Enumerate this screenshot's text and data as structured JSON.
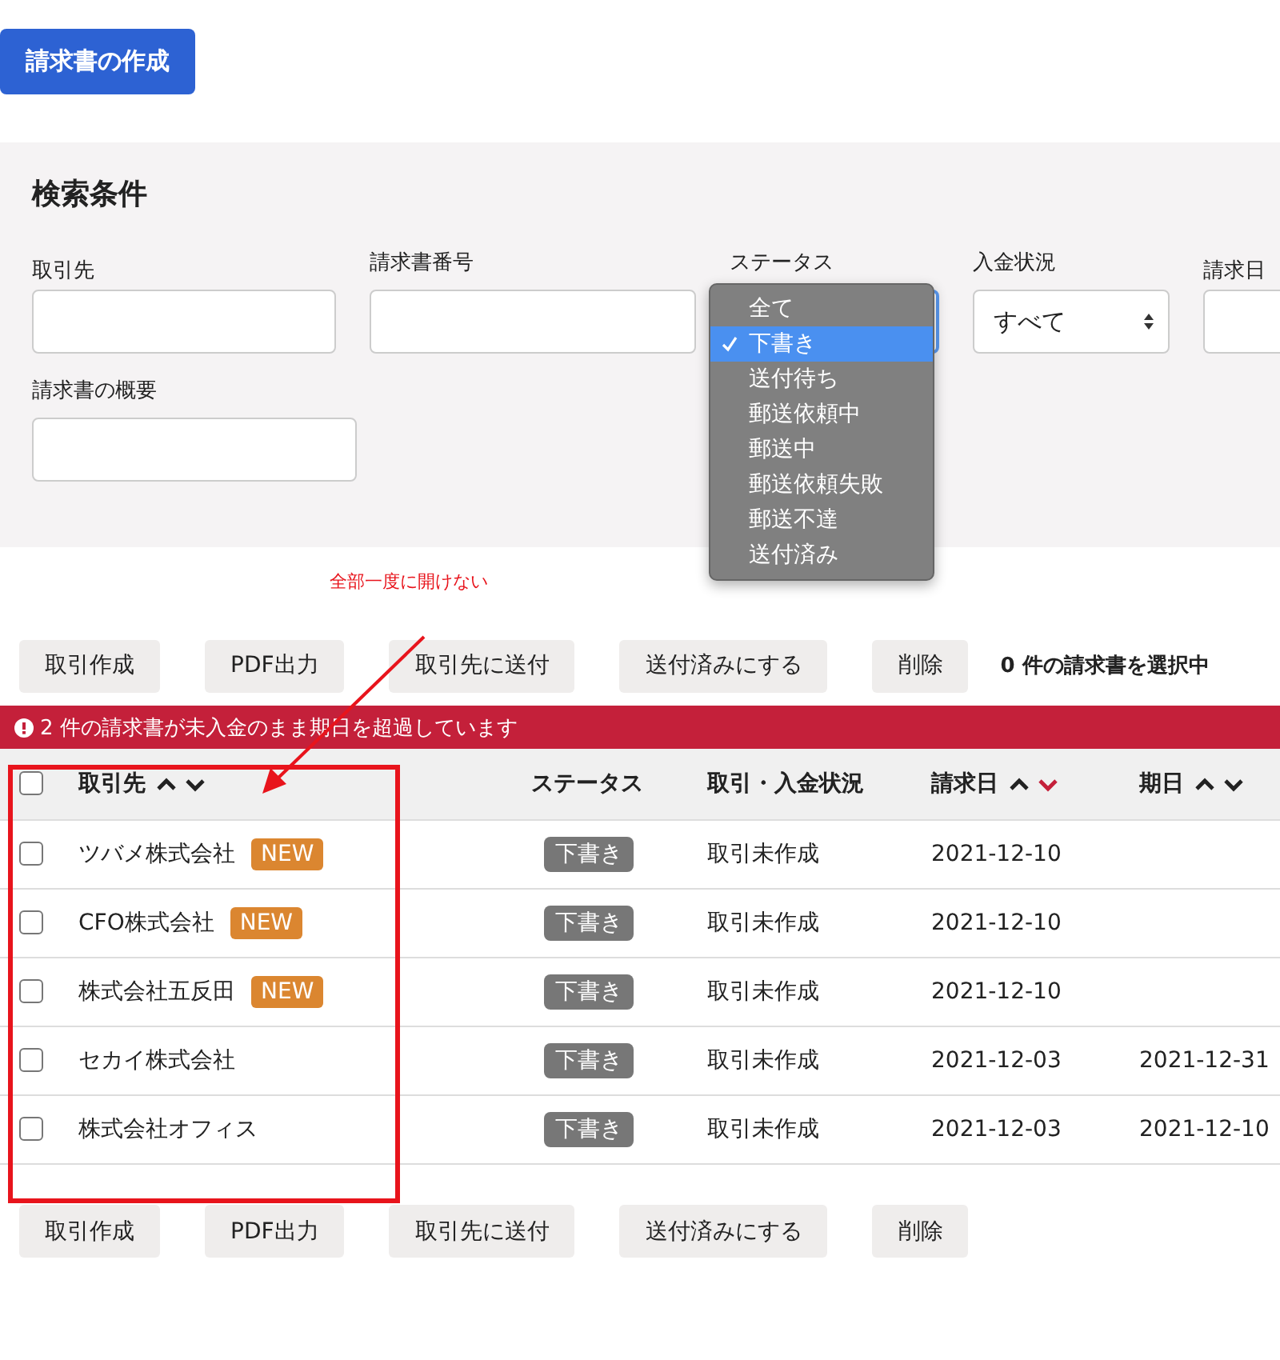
{
  "create_button": "請求書の作成",
  "search": {
    "title": "検索条件",
    "rows": [
      [
        {
          "label": "取引先",
          "kind": "text"
        },
        {
          "label": "請求書番号",
          "kind": "text"
        },
        {
          "label": "ステータス",
          "kind": "select_open"
        },
        {
          "label": "入金状況",
          "kind": "select",
          "value": "すべて"
        },
        {
          "label": "請求日",
          "kind": "text"
        }
      ],
      [
        {
          "label": "請求書の概要",
          "kind": "text"
        }
      ]
    ]
  },
  "status_menu": {
    "options": [
      {
        "label": "全て",
        "selected": false
      },
      {
        "label": "下書き",
        "selected": true
      },
      {
        "label": "送付待ち",
        "selected": false
      },
      {
        "label": "郵送依頼中",
        "selected": false
      },
      {
        "label": "郵送中",
        "selected": false
      },
      {
        "label": "郵送依頼失敗",
        "selected": false
      },
      {
        "label": "郵送不達",
        "selected": false
      },
      {
        "label": "送付済み",
        "selected": false
      }
    ]
  },
  "annotation": {
    "text": "全部一度に開けない"
  },
  "actions": [
    "取引作成",
    "PDF出力",
    "取引先に送付",
    "送付済みにする",
    "削除"
  ],
  "selection_count": "0 件の請求書を選択中",
  "alert": "2 件の請求書が未入金のまま期日を超過しています",
  "table": {
    "all_checked": false,
    "columns": [
      {
        "label": "取引先",
        "sortable": true,
        "sorted_desc": false
      },
      {
        "label": "ステータス",
        "sortable": false
      },
      {
        "label": "取引・入金状況",
        "sortable": false
      },
      {
        "label": "請求日",
        "sortable": true,
        "sorted_desc": true
      },
      {
        "label": "期日",
        "sortable": true,
        "sorted_desc": false
      }
    ],
    "rows": [
      {
        "checked": false,
        "name": "ツバメ株式会社",
        "badge": "NEW",
        "status": "下書き",
        "deal": "取引未作成",
        "date": "2021-12-10"
      },
      {
        "checked": false,
        "name": "CFO株式会社",
        "badge": "NEW",
        "status": "下書き",
        "deal": "取引未作成",
        "date": "2021-12-10"
      },
      {
        "checked": false,
        "name": "株式会社五反田",
        "badge": "NEW",
        "status": "下書き",
        "deal": "取引未作成",
        "date": "2021-12-10"
      },
      {
        "checked": false,
        "name": "セカイ株式会社",
        "status": "下書き",
        "deal": "取引未作成",
        "date": "2021-12-03",
        "due": "2021-12-31"
      },
      {
        "checked": false,
        "name": "株式会社オフィス",
        "status": "下書き",
        "deal": "取引未作成",
        "date": "2021-12-03",
        "due": "2021-12-10"
      }
    ]
  },
  "bottom_actions": [
    "取引作成",
    "PDF出力",
    "取引先に送付",
    "送付済みにする",
    "削除"
  ]
}
